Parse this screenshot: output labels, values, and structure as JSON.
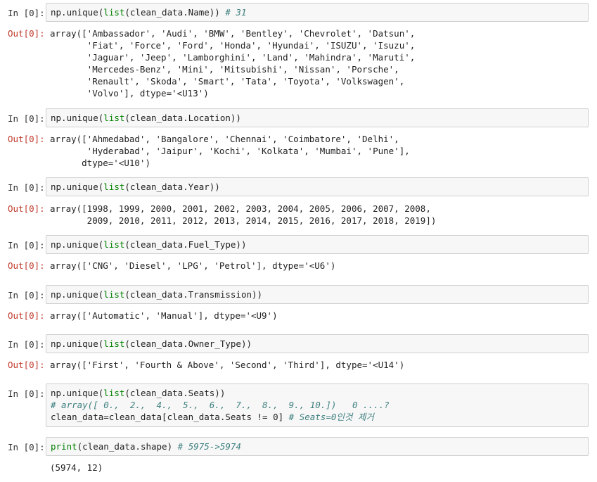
{
  "cells": [
    {
      "in_prompt": "In [0]:",
      "code": [
        {
          "pre": "np.unique(",
          "fn": "list",
          "post": "(clean_data.Name)) ",
          "comment": "# 31"
        }
      ],
      "out_prompt": "Out[0]:",
      "output": "array(['Ambassador', 'Audi', 'BMW', 'Bentley', 'Chevrolet', 'Datsun',\n       'Fiat', 'Force', 'Ford', 'Honda', 'Hyundai', 'ISUZU', 'Isuzu',\n       'Jaguar', 'Jeep', 'Lamborghini', 'Land', 'Mahindra', 'Maruti',\n       'Mercedes-Benz', 'Mini', 'Mitsubishi', 'Nissan', 'Porsche',\n       'Renault', 'Skoda', 'Smart', 'Tata', 'Toyota', 'Volkswagen',\n       'Volvo'], dtype='<U13')"
    },
    {
      "in_prompt": "In [0]:",
      "code": [
        {
          "pre": "np.unique(",
          "fn": "list",
          "post": "(clean_data.Location))",
          "comment": ""
        }
      ],
      "out_prompt": "Out[0]:",
      "output": "array(['Ahmedabad', 'Bangalore', 'Chennai', 'Coimbatore', 'Delhi',\n       'Hyderabad', 'Jaipur', 'Kochi', 'Kolkata', 'Mumbai', 'Pune'],\n      dtype='<U10')"
    },
    {
      "in_prompt": "In [0]:",
      "code": [
        {
          "pre": "np.unique(",
          "fn": "list",
          "post": "(clean_data.Year))",
          "comment": ""
        }
      ],
      "out_prompt": "Out[0]:",
      "output": "array([1998, 1999, 2000, 2001, 2002, 2003, 2004, 2005, 2006, 2007, 2008,\n       2009, 2010, 2011, 2012, 2013, 2014, 2015, 2016, 2017, 2018, 2019])"
    },
    {
      "in_prompt": "In [0]:",
      "code": [
        {
          "pre": "np.unique(",
          "fn": "list",
          "post": "(clean_data.Fuel_Type))",
          "comment": ""
        }
      ],
      "out_prompt": "Out[0]:",
      "output": "array(['CNG', 'Diesel', 'LPG', 'Petrol'], dtype='<U6')"
    },
    {
      "in_prompt": "In [0]:",
      "code": [
        {
          "pre": "np.unique(",
          "fn": "list",
          "post": "(clean_data.Transmission))",
          "comment": ""
        }
      ],
      "out_prompt": "Out[0]:",
      "output": "array(['Automatic', 'Manual'], dtype='<U9')"
    },
    {
      "in_prompt": "In [0]:",
      "code": [
        {
          "pre": "np.unique(",
          "fn": "list",
          "post": "(clean_data.Owner_Type))",
          "comment": ""
        }
      ],
      "out_prompt": "Out[0]:",
      "output": "array(['First', 'Fourth & Above', 'Second', 'Third'], dtype='<U14')"
    },
    {
      "in_prompt": "In [0]:",
      "code": [
        {
          "pre": "np.unique(",
          "fn": "list",
          "post": "(clean_data.Seats))",
          "comment": ""
        },
        {
          "pre": "",
          "fn": "",
          "post": "",
          "comment": "# array([ 0.,  2.,  4.,  5.,  6.,  7.,  8.,  9., 10.])   0 ....?"
        },
        {
          "pre": "clean_data=clean_data[clean_data.Seats != 0] ",
          "fn": "",
          "post": "",
          "comment": "# Seats=0인것 제거"
        }
      ],
      "out_prompt": "",
      "output": ""
    },
    {
      "in_prompt": "In [0]:",
      "code": [
        {
          "pre": "",
          "fn": "print",
          "post": "(clean_data.shape) ",
          "comment": "# 5975->5974"
        }
      ],
      "out_prompt": "",
      "output": "(5974, 12)"
    }
  ]
}
